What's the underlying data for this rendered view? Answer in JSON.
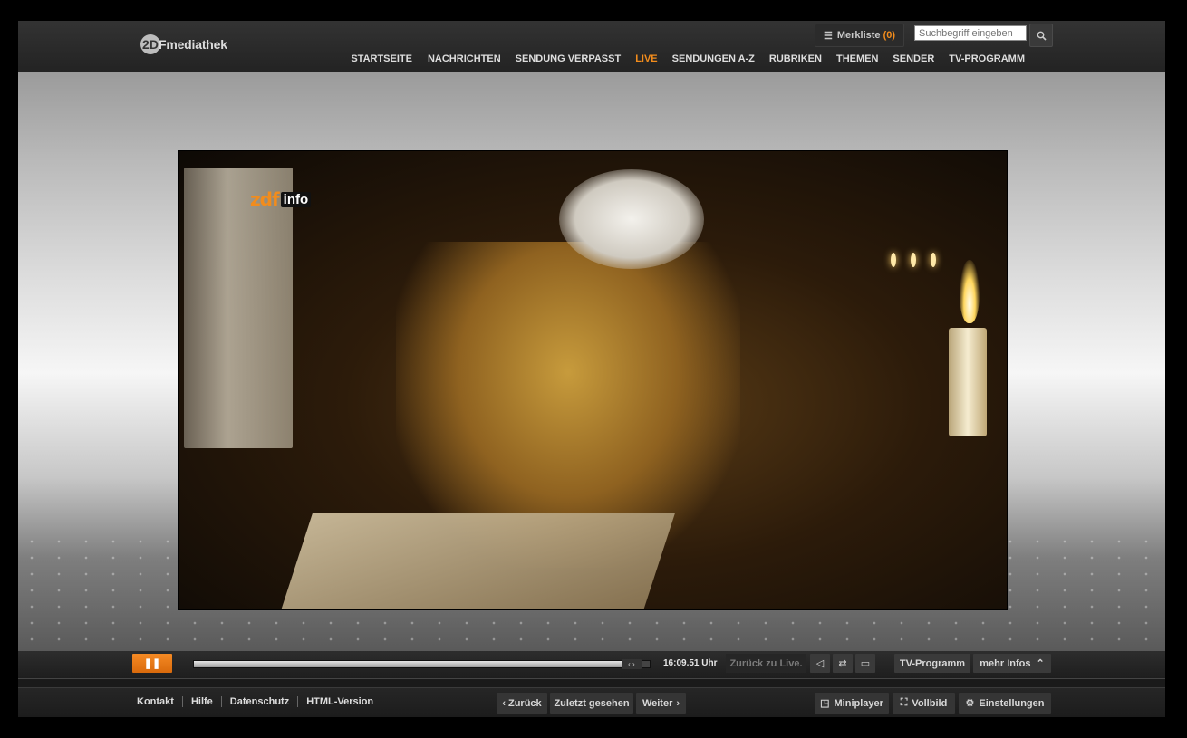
{
  "header": {
    "logo_badge": "2D",
    "logo_text": "Fmediathek",
    "merkliste_label": "Merkliste",
    "merkliste_count": "(0)",
    "search_placeholder": "Suchbegriff eingeben",
    "search_icon": "search-icon",
    "nav": [
      {
        "label": "STARTSEITE"
      },
      {
        "label": "NACHRICHTEN"
      },
      {
        "label": "SENDUNG VERPASST"
      },
      {
        "label": "LIVE",
        "active": true
      },
      {
        "label": "SENDUNGEN A-Z"
      },
      {
        "label": "RUBRIKEN"
      },
      {
        "label": "THEMEN"
      },
      {
        "label": "SENDER"
      },
      {
        "label": "TV-PROGRAMM"
      }
    ],
    "accent_color": "#f28c1c"
  },
  "player": {
    "channel_logo_zdf": "zdf",
    "channel_logo_info": "info",
    "progress": 0.96,
    "time": "16:09.51 Uhr",
    "back_to_live": "Zurück zu Live.",
    "tv_programm": "TV-Programm",
    "mehr_infos": "mehr Infos",
    "icons": [
      "pause-icon",
      "mute-icon",
      "settings-sliders-icon",
      "chat-icon",
      "chevron-up-icon"
    ]
  },
  "footer": {
    "links": [
      "Kontakt",
      "Hilfe",
      "Datenschutz",
      "HTML-Version"
    ],
    "back": "Zurück",
    "recent": "Zuletzt gesehen",
    "next": "Weiter",
    "miniplayer": "Miniplayer",
    "fullscreen": "Vollbild",
    "settings": "Einstellungen"
  }
}
